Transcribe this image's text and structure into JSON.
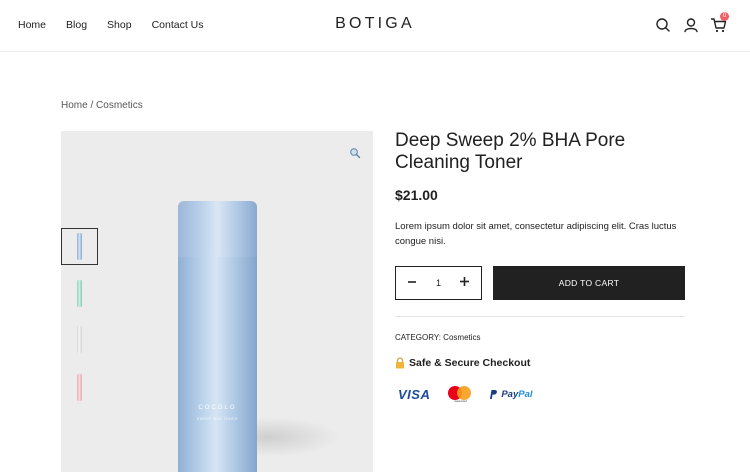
{
  "nav": {
    "items": [
      "Home",
      "Blog",
      "Shop",
      "Contact Us"
    ]
  },
  "logo": "BOTIGA",
  "header_icons": {
    "search": "search-icon",
    "account": "user-icon",
    "cart": "cart-icon",
    "cart_count": "0",
    "badge_color": "#f0626a"
  },
  "breadcrumb": {
    "home": "Home",
    "separator": " / ",
    "current": "Cosmetics"
  },
  "gallery": {
    "zoom_icon": "magnifier-icon",
    "product_brand": "COCOLO",
    "product_sub": "SWEEP BHA TONER",
    "thumbnails": [
      {
        "name": "blue",
        "color": "#a9c3e1"
      },
      {
        "name": "green",
        "color": "#a8dccb"
      },
      {
        "name": "white",
        "color": "#e4e4e4"
      },
      {
        "name": "pink",
        "color": "#efc3c8"
      }
    ]
  },
  "product": {
    "title": "Deep Sweep 2% BHA Pore Cleaning Toner",
    "price": "$21.00",
    "description": "Lorem ipsum dolor sit amet, consectetur adipiscing elit. Cras luctus congue nisi.",
    "quantity": "1",
    "minus": "-",
    "plus": "+",
    "add_to_cart": "ADD TO CART",
    "category_label": "CATEGORY:",
    "category_value": "Cosmetics",
    "secure_checkout": "Safe & Secure Checkout"
  },
  "payments": {
    "visa": "VISA",
    "mastercard": "mastercard",
    "paypal_1": "Pay",
    "paypal_2": "Pal"
  }
}
